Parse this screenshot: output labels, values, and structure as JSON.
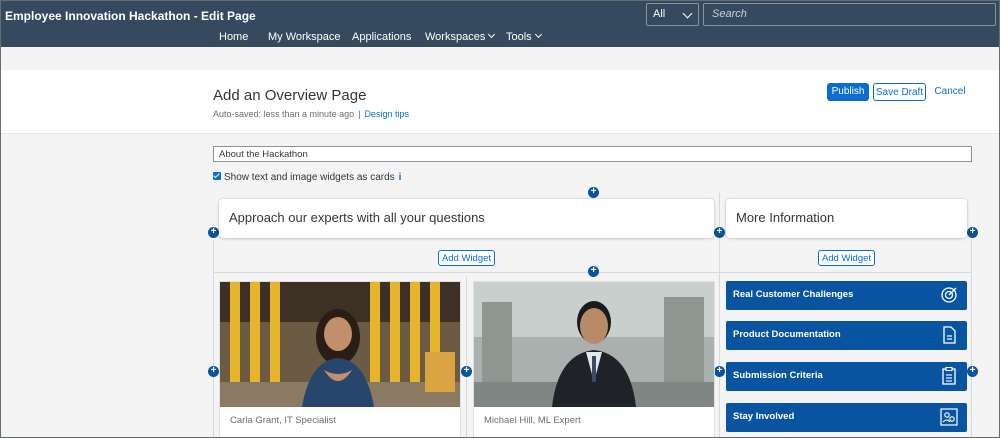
{
  "shell": {
    "app_title": "Employee Innovation Hackathon - Edit Page",
    "scope_value": "All",
    "search_placeholder": "Search",
    "nav": [
      {
        "label": "Home"
      },
      {
        "label": "My Workspace"
      },
      {
        "label": "Applications"
      },
      {
        "label": "Workspaces"
      },
      {
        "label": "Tools"
      }
    ]
  },
  "header": {
    "title": "Add an Overview Page",
    "autosave": "Auto-saved: less than a minute ago",
    "separator": "|",
    "design_tips": "Design tips",
    "publish": "Publish",
    "save_draft": "Save Draft",
    "cancel": "Cancel"
  },
  "form": {
    "page_name": "About the Hackathon",
    "cards_checkbox_label": "Show text and image widgets as cards",
    "cards_checkbox_checked": true,
    "info_icon": "i"
  },
  "plus_glyph": "+",
  "layout": {
    "left_heading": "Approach our experts with all your questions",
    "right_heading": "More Information",
    "add_widget": "Add Widget"
  },
  "people": [
    {
      "caption": "Carla Grant, IT Specialist"
    },
    {
      "caption": "Michael Hill, ML Expert"
    }
  ],
  "tiles": [
    {
      "label": "Real Customer Challenges",
      "icon": "target-icon"
    },
    {
      "label": "Product Documentation",
      "icon": "document-icon"
    },
    {
      "label": "Submission Criteria",
      "icon": "clipboard-icon"
    },
    {
      "label": "Stay Involved",
      "icon": "people-network-icon"
    }
  ],
  "colors": {
    "shell": "#354a5f",
    "accent": "#0a6ed1",
    "tile": "#0854a0"
  }
}
